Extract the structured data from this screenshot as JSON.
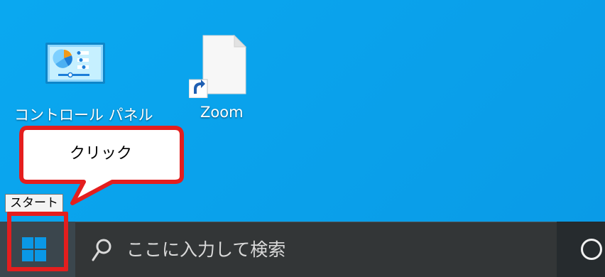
{
  "desktop": {
    "icons": [
      {
        "label": "コントロール パネル",
        "icon": "control-panel-icon"
      },
      {
        "label": "Zoom",
        "icon": "file-shortcut-icon"
      }
    ]
  },
  "callout": {
    "text": "クリック",
    "border_color": "#e41e1e"
  },
  "tooltip": {
    "text": "スタート"
  },
  "taskbar": {
    "start_icon": "windows-logo-icon",
    "search_icon": "search-icon",
    "search_placeholder": "ここに入力して検索",
    "cortana_icon": "cortana-circle-icon",
    "background": "#262b2e",
    "search_background": "#333637"
  },
  "colors": {
    "desktop_background": "#0aa8f0",
    "windows_blue": "#0a98e6",
    "highlight_red": "#e41e1e"
  }
}
